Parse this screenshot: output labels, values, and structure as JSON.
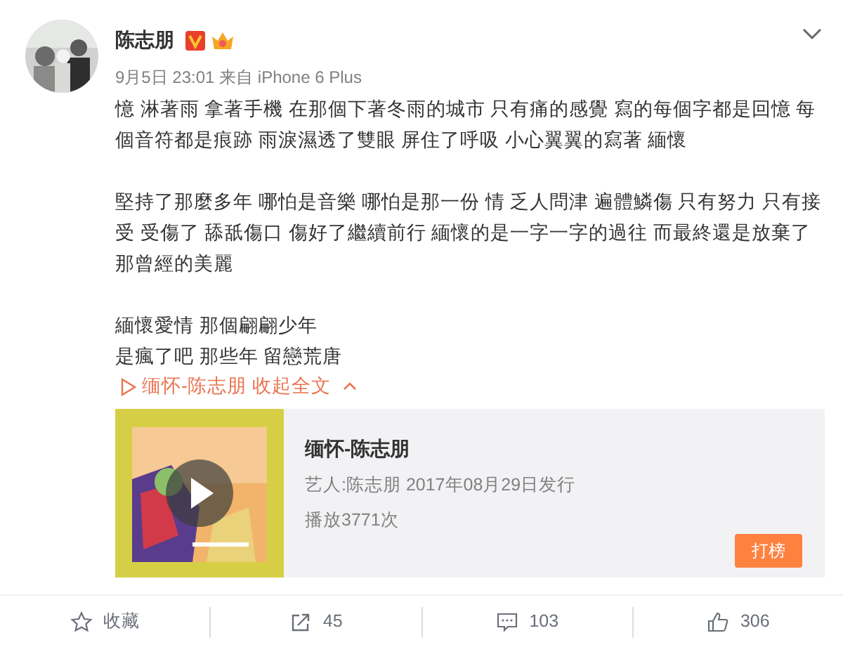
{
  "author": {
    "name": "陈志朋",
    "verified": true,
    "vip": true
  },
  "meta": {
    "time": "9月5日 23:01",
    "source_prefix": "来自",
    "source": "iPhone 6 Plus"
  },
  "paragraphs": [
    [
      "憶 淋著雨 拿著手機 在那個下著冬雨的城市 只有痛的感覺 寫的每個字都是回憶 每個音符都是痕跡 雨淚濕透了雙眼 屏住了呼吸 小心翼翼的寫著 緬懷"
    ],
    [
      "堅持了那麼多年 哪怕是音樂 哪怕是那一份  情 乏人問津 遍體鱗傷 只有努力 只有接受 受傷了 舔舐傷口 傷好了繼續前行 緬懷的是一字一字的過往 而最終還是放棄了那曾經的美麗"
    ],
    [
      "緬懷愛情 那個翩翩少年",
      "是瘋了吧 那些年 留戀荒唐"
    ]
  ],
  "links": {
    "music": "缅怀-陈志朋",
    "collapse": "收起全文"
  },
  "music_card": {
    "title": "缅怀-陈志朋",
    "artist_line": "艺人:陈志朋 2017年08月29日发行",
    "plays": "播放3771次",
    "button": "打榜"
  },
  "actions": [
    {
      "kind": "favorite",
      "label": "收藏"
    },
    {
      "kind": "share",
      "label": "45"
    },
    {
      "kind": "comment",
      "label": "103"
    },
    {
      "kind": "like",
      "label": "306"
    }
  ]
}
